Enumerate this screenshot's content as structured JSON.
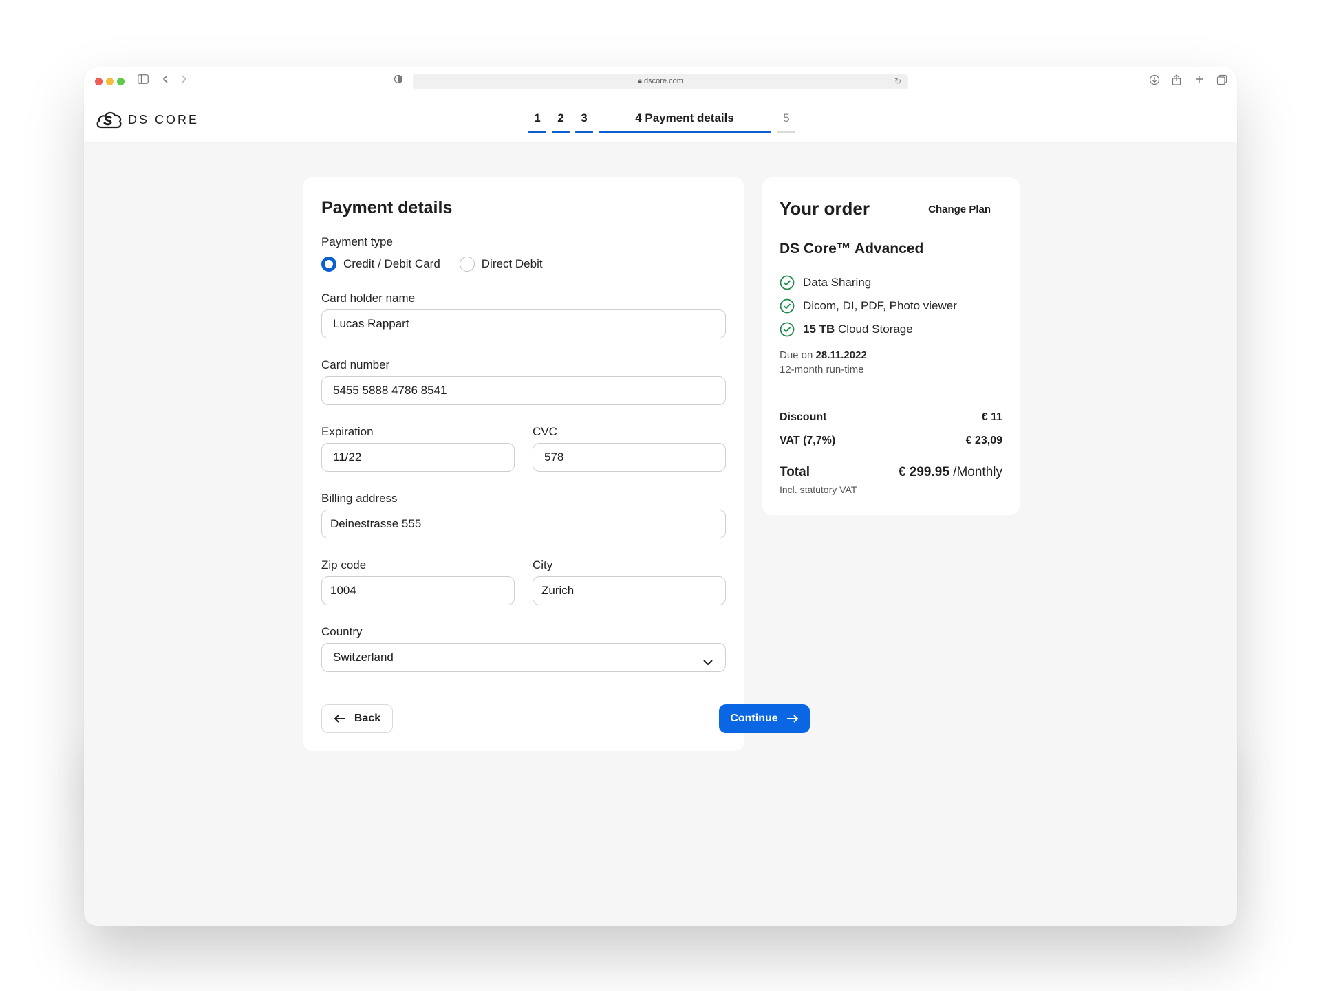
{
  "browser": {
    "url": "dscore.com"
  },
  "app": {
    "logo_text": "DS CORE",
    "steps": [
      {
        "label": "1"
      },
      {
        "label": "2"
      },
      {
        "label": "3"
      },
      {
        "label": "4 Payment details"
      },
      {
        "label": "5"
      }
    ]
  },
  "payment": {
    "title": "Payment details",
    "payment_type_label": "Payment type",
    "options": [
      "Credit / Debit Card",
      "Direct Debit"
    ],
    "selected_option": "Credit / Debit Card",
    "card_holder": {
      "label": "Card holder name",
      "value": "Lucas Rappart"
    },
    "card_number": {
      "label": "Card number",
      "value": "5455 5888 4786 8541"
    },
    "expiration": {
      "label": "Expiration",
      "value": "11/22"
    },
    "cvc": {
      "label": "CVC",
      "value": "578"
    },
    "billing": {
      "label": "Billing address",
      "value": "Deinestrasse 555"
    },
    "zip": {
      "label": "Zip code",
      "value": "1004"
    },
    "city": {
      "label": "City",
      "value": "Zurich"
    },
    "country": {
      "label": "Country",
      "value": "Switzerland"
    },
    "back_label": "Back",
    "continue_label": "Continue"
  },
  "order": {
    "title": "Your order",
    "change_plan": "Change Plan",
    "plan_name": "DS Core™ Advanced",
    "features": [
      {
        "bold": "",
        "text": "Data Sharing"
      },
      {
        "bold": "",
        "text": "Dicom, DI, PDF, Photo viewer"
      },
      {
        "bold": "15 TB",
        "text": " Cloud Storage"
      }
    ],
    "due_prefix": "Due on ",
    "due_date": "28.11.2022",
    "runtime": "12-month run-time",
    "discount_label": "Discount",
    "discount_value": "€ 11",
    "vat_label": "VAT (7,7%)",
    "vat_value": "€ 23,09",
    "total_label": "Total",
    "total_value": "€ 299.95",
    "total_period": " /Monthly",
    "incl_vat": "Incl. statutory VAT"
  },
  "colors": {
    "accent": "#0b66e4",
    "check": "#1f8a4c"
  }
}
